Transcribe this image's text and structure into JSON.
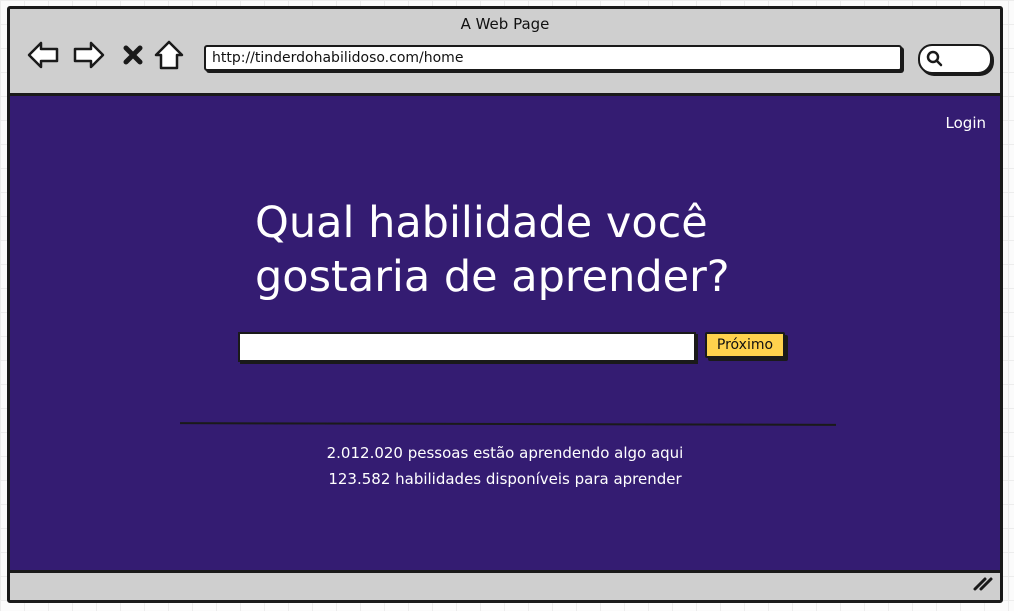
{
  "window": {
    "title": "A Web Page"
  },
  "toolbar": {
    "back_icon": "arrow-left-icon",
    "forward_icon": "arrow-right-icon",
    "stop_icon": "close-icon",
    "home_icon": "home-icon",
    "url": "http://tinderdohabilidoso.com/home",
    "search_icon": "search-icon"
  },
  "header": {
    "login_label": "Login"
  },
  "hero": {
    "headline": "Qual habilidade você gostaria de aprender?",
    "input_value": "",
    "next_label": "Próximo"
  },
  "stats": {
    "learners": "2.012.020 pessoas estão aprendendo algo aqui",
    "skills": "123.582 habilidades disponíveis para aprender"
  },
  "colors": {
    "background": "#341c72",
    "button": "#ffd24d",
    "chrome": "#cfcfcf"
  }
}
